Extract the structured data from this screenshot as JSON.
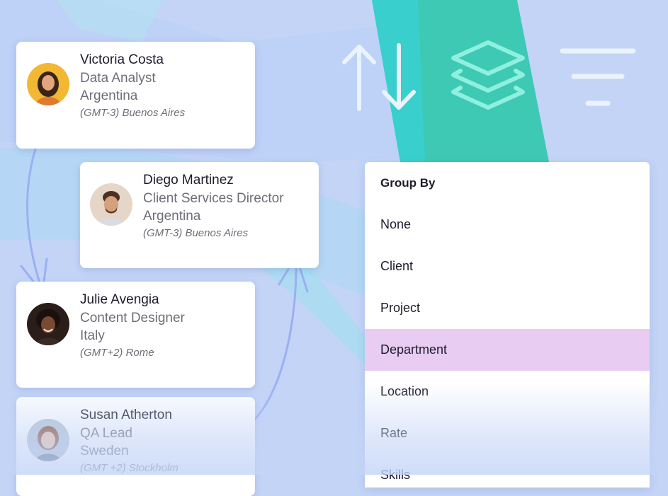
{
  "people": [
    {
      "name": "Victoria Costa",
      "role": "Data Analyst",
      "country": "Argentina",
      "timezone": "(GMT-3) Buenos Aires",
      "avatar": "avatar-victoria"
    },
    {
      "name": "Diego Martinez",
      "role": "Client Services Director",
      "country": "Argentina",
      "timezone": "(GMT-3) Buenos Aires",
      "avatar": "avatar-diego"
    },
    {
      "name": "Julie Avengia",
      "role": "Content Designer",
      "country": "Italy",
      "timezone": "(GMT+2) Rome",
      "avatar": "avatar-julie"
    },
    {
      "name": "Susan Atherton",
      "role": "QA Lead",
      "country": "Sweden",
      "timezone": "(GMT +2) Stockholm",
      "avatar": "avatar-susan"
    }
  ],
  "group_by": {
    "title": "Group By",
    "options": [
      "None",
      "Client",
      "Project",
      "Department",
      "Location",
      "Rate",
      "Skills"
    ],
    "selected": "Department"
  },
  "toolbar": {
    "icons": [
      "sort-icon",
      "layers-icon",
      "filter-icon"
    ]
  },
  "colors": {
    "background": "#c3d4f7",
    "accent_teal": "#3ec9b4",
    "selected_row": "#e8ccf2",
    "arrow": "#9bb0f2"
  }
}
